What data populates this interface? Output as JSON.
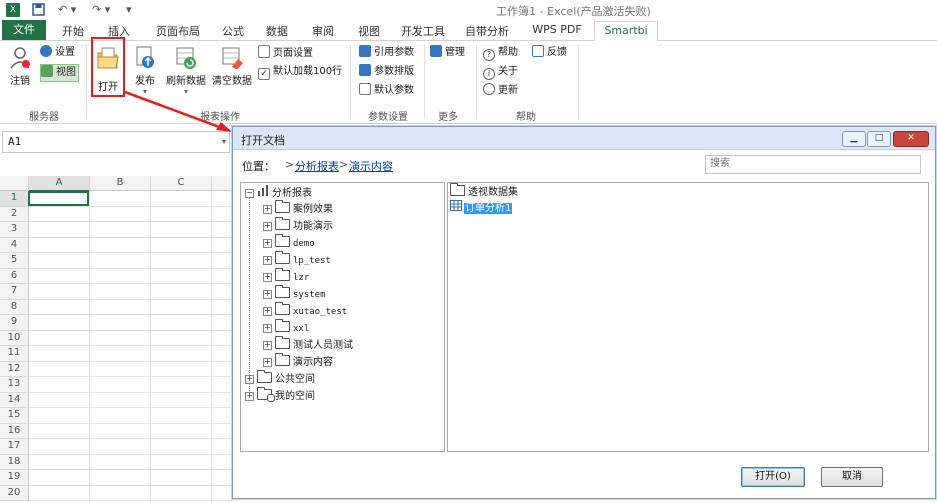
{
  "window": {
    "title": "工作簿1 - Excel(产品激活失败)",
    "quick_access": [
      "save-icon",
      "undo-icon",
      "redo-icon",
      "customize-icon"
    ]
  },
  "tabs": {
    "file": "文件",
    "items": [
      "开始",
      "插入",
      "页面布局",
      "公式",
      "数据",
      "审阅",
      "视图",
      "开发工具",
      "自带分析",
      "WPS PDF",
      "Smartbi"
    ],
    "active": "Smartbi"
  },
  "ribbon": {
    "server": {
      "logout": "注销",
      "settings": "设置",
      "view": "视图",
      "group_label": "服务器"
    },
    "report": {
      "open": "打开",
      "publish": "发布",
      "refresh": "刷新数据",
      "clear": "清空数据",
      "page_setup": "页面设置",
      "default_load": "默认加载100行",
      "group_label": "报表操作"
    },
    "params": {
      "ref_params": "引用参数",
      "param_layout": "参数排版",
      "default_params": "默认参数",
      "group_label": "参数设置"
    },
    "more": {
      "manage": "管理",
      "group_label": "更多"
    },
    "help": {
      "help": "帮助",
      "feedback": "反馈",
      "about": "关于",
      "update": "更新",
      "group_label": "帮助"
    }
  },
  "formula_bar": {
    "name_box": "A1"
  },
  "grid": {
    "columns": [
      "A",
      "B",
      "C"
    ],
    "rows": [
      "1",
      "2",
      "3",
      "4",
      "5",
      "6",
      "7",
      "8",
      "9",
      "10",
      "11",
      "12",
      "13",
      "14",
      "15",
      "16",
      "17",
      "18",
      "19",
      "20"
    ]
  },
  "dialog": {
    "title": "打开文档",
    "location_label": "位置：",
    "path": [
      "分析报表",
      "演示内容"
    ],
    "path_sep": ">",
    "search_placeholder": "搜索",
    "tree": [
      {
        "label": "分析报表",
        "level": 0,
        "expanded": true,
        "icon": "chart-icon"
      },
      {
        "label": "案例效果",
        "level": 1,
        "icon": "folder-icon"
      },
      {
        "label": "功能演示",
        "level": 1,
        "icon": "folder-icon"
      },
      {
        "label": "demo",
        "level": 1,
        "icon": "folder-icon"
      },
      {
        "label": "lp_test",
        "level": 1,
        "icon": "folder-icon"
      },
      {
        "label": "lzr",
        "level": 1,
        "icon": "folder-icon"
      },
      {
        "label": "system",
        "level": 1,
        "icon": "folder-icon"
      },
      {
        "label": "xutao_test",
        "level": 1,
        "icon": "folder-icon"
      },
      {
        "label": "xxl",
        "level": 1,
        "icon": "folder-icon"
      },
      {
        "label": "测试人员测试",
        "level": 1,
        "icon": "folder-icon"
      },
      {
        "label": "演示内容",
        "level": 1,
        "icon": "folder-icon",
        "selected": true
      },
      {
        "label": "公共空间",
        "level": 0,
        "icon": "folder-icon"
      },
      {
        "label": "我的空间",
        "level": 0,
        "icon": "user-folder-icon"
      }
    ],
    "files": [
      {
        "label": "透视数据集",
        "icon": "folder-icon"
      },
      {
        "label": "订单分析1",
        "icon": "report-icon",
        "selected": true
      }
    ],
    "open_button": "打开(O)",
    "cancel_button": "取消"
  },
  "colors": {
    "excel_green": "#217346",
    "highlight": "#3399ff",
    "annotation_red": "#e02020"
  }
}
